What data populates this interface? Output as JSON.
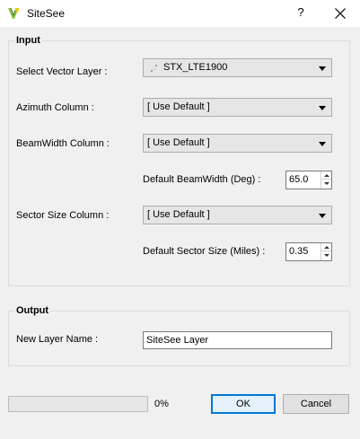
{
  "window": {
    "title": "SiteSee",
    "help_glyph": "?"
  },
  "input_group": {
    "title": "Input",
    "vector_layer": {
      "label": "Select Vector Layer :",
      "value": "STX_LTE1900"
    },
    "azimuth": {
      "label": "Azimuth Column :",
      "value": "[ Use Default ]"
    },
    "beamwidth": {
      "label": "BeamWidth Column :",
      "value": "[ Use Default ]"
    },
    "default_beamwidth": {
      "label": "Default BeamWidth (Deg) :",
      "value": "65.0"
    },
    "sector_size": {
      "label": "Sector Size Column :",
      "value": "[ Use Default ]"
    },
    "default_sector_size": {
      "label": "Default Sector Size (Miles) :",
      "value": "0.35"
    }
  },
  "output_group": {
    "title": "Output",
    "layer_name": {
      "label": "New Layer Name :",
      "value": "SiteSee Layer"
    }
  },
  "progress": {
    "percent_text": "0%",
    "value": 0
  },
  "buttons": {
    "ok": "OK",
    "cancel": "Cancel"
  },
  "colors": {
    "accent": "#0078d7",
    "progress_fill": "#06b025"
  }
}
